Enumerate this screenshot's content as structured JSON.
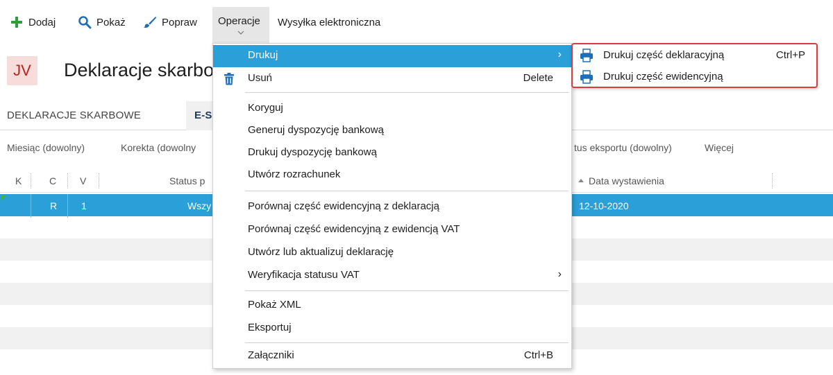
{
  "toolbar": {
    "add_label": "Dodaj",
    "show_label": "Pokaż",
    "edit_label": "Popraw",
    "operations_label": "Operacje",
    "esend_label": "Wysyłka elektroniczna"
  },
  "header": {
    "badge": "JV",
    "title": "Deklaracje skarbo"
  },
  "tabs": {
    "tab1": "DEKLARACJE SKARBOWE",
    "tab2": "E-S"
  },
  "filters": {
    "month": "Miesiąc (dowolny)",
    "correction": "Korekta (dowolny",
    "export_status": "tus eksportu (dowolny)",
    "more": "Więcej"
  },
  "grid": {
    "col_k": "K",
    "col_c": "C",
    "col_v": "V",
    "col_status": "Status p",
    "col_date": "Data wystawienia",
    "row": {
      "c": "R",
      "v": "1",
      "status": "Wszy",
      "date": "12-10-2020"
    }
  },
  "menu": {
    "print": "Drukuj",
    "delete": "Usuń",
    "delete_shortcut": "Delete",
    "correct": "Koryguj",
    "gen_bank": "Generuj dyspozycję bankową",
    "print_bank": "Drukuj dyspozycję bankową",
    "create_settlement": "Utwórz rozrachunek",
    "compare_decl": "Porównaj część ewidencyjną z deklaracją",
    "compare_vat": "Porównaj część ewidencyjną z ewidencją VAT",
    "create_update": "Utwórz lub aktualizuj deklarację",
    "verify_vat": "Weryfikacja statusu VAT",
    "show_xml": "Pokaż XML",
    "export": "Eksportuj",
    "attachments": "Załączniki",
    "attachments_shortcut": "Ctrl+B"
  },
  "submenu": {
    "print_decl": "Drukuj część deklaracyjną",
    "print_decl_shortcut": "Ctrl+P",
    "print_record": "Drukuj część ewidencyjną"
  },
  "colors": {
    "accent": "#2a9fd8",
    "add_green": "#2e9e3b",
    "icon_blue": "#1f6fb8",
    "submenu_border": "#d93a3a",
    "badge_bg": "#f7dcdc",
    "badge_text": "#b3261e"
  },
  "icons": {
    "add": "plus-icon",
    "show": "search-icon",
    "edit": "brush-icon",
    "delete": "trash-icon",
    "print": "printer-icon"
  }
}
